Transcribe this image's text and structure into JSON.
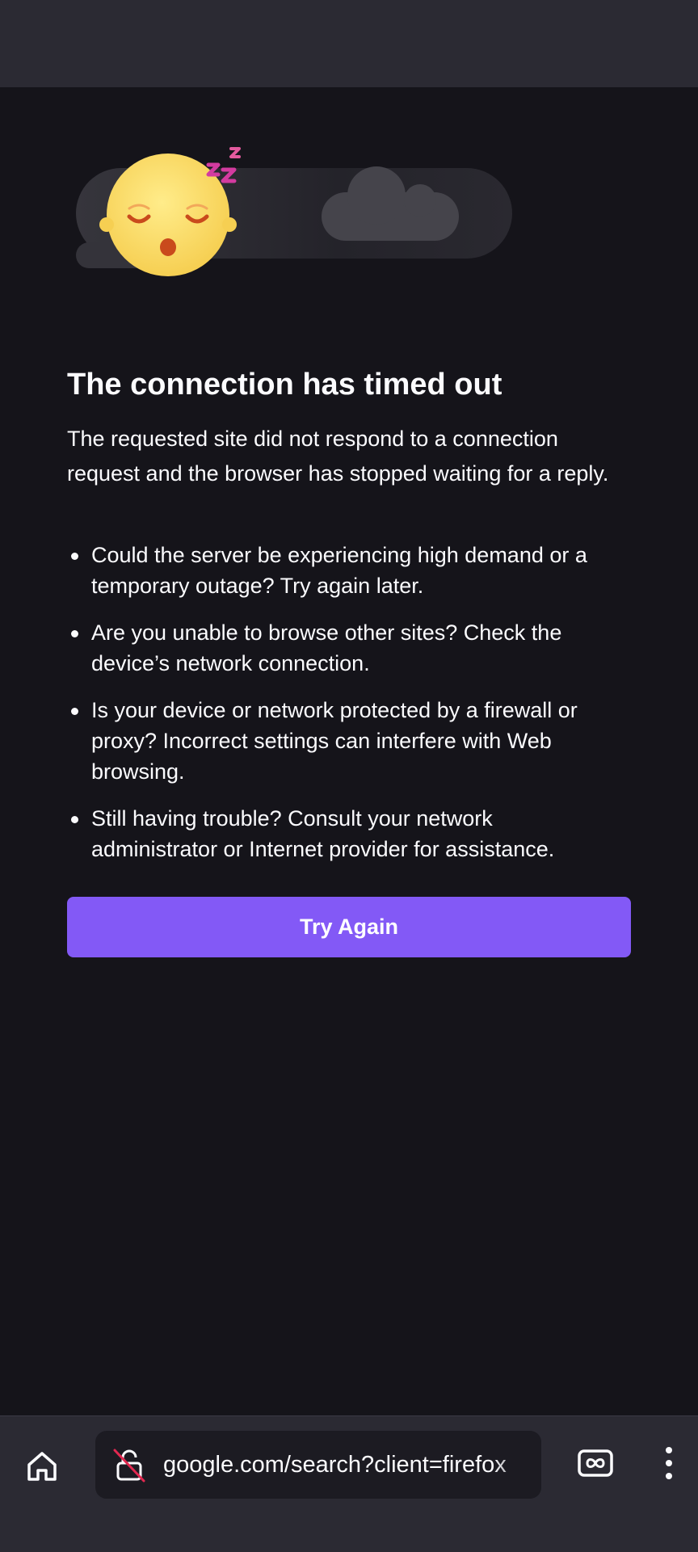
{
  "error_page": {
    "title": "The connection has timed out",
    "intro": "The requested site did not respond to a connection request and the browser has stopped waiting for a reply.",
    "tips": [
      "Could the server be experiencing high demand or a temporary outage? Try again later.",
      "Are you unable to browse other sites? Check the device’s network connection.",
      "Is your device or network protected by a firewall or proxy? Incorrect settings can interfere with Web browsing.",
      "Still having trouble? Consult your network administrator or Internet provider for assistance."
    ],
    "try_again_label": "Try Again",
    "illustration": "sleeping-face-with-clouds"
  },
  "toolbar": {
    "url": "google.com/search?client=firefox",
    "icons": [
      "home-icon",
      "broken-lock-icon",
      "private-tabs-icon",
      "more-vert-icon"
    ]
  },
  "colors": {
    "page_background": "#15141a",
    "toolbar_background": "#2b2a33",
    "url_bar_background": "#1c1b22",
    "accent": "#8359f6",
    "text": "#fbfbfe"
  }
}
